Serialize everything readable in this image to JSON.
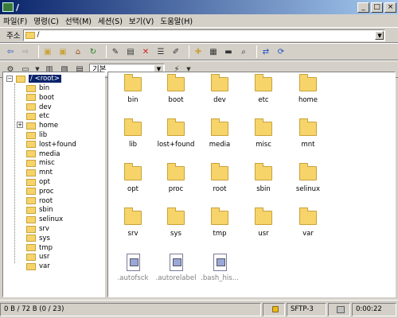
{
  "window": {
    "title": "/"
  },
  "menu": [
    "파일(F)",
    "명령(C)",
    "선택(M)",
    "세션(S)",
    "보기(V)",
    "도움말(H)"
  ],
  "address": {
    "label": "주소",
    "value": "/"
  },
  "toolbar": {
    "view_mode": "기본"
  },
  "tree": {
    "root_label": "/ <root>",
    "items": [
      "bin",
      "boot",
      "dev",
      "etc",
      "home",
      "lib",
      "lost+found",
      "media",
      "misc",
      "mnt",
      "opt",
      "proc",
      "root",
      "sbin",
      "selinux",
      "srv",
      "sys",
      "tmp",
      "usr",
      "var"
    ]
  },
  "files": {
    "folders": [
      "bin",
      "boot",
      "dev",
      "etc",
      "home",
      "lib",
      "lost+found",
      "media",
      "misc",
      "mnt",
      "opt",
      "proc",
      "root",
      "sbin",
      "selinux",
      "srv",
      "sys",
      "tmp",
      "usr",
      "var"
    ],
    "hidden_files": [
      ".autofsck",
      ".autorelabel",
      ".bash_his..."
    ]
  },
  "status": {
    "selection": "0 B / 72 B (0 / 23)",
    "protocol": "SFTP-3",
    "elapsed": "0:00:22"
  },
  "colors": {
    "title_gradient_start": "#0a246a",
    "folder_yellow": "#f6d46a",
    "face": "#d4d0c8"
  }
}
